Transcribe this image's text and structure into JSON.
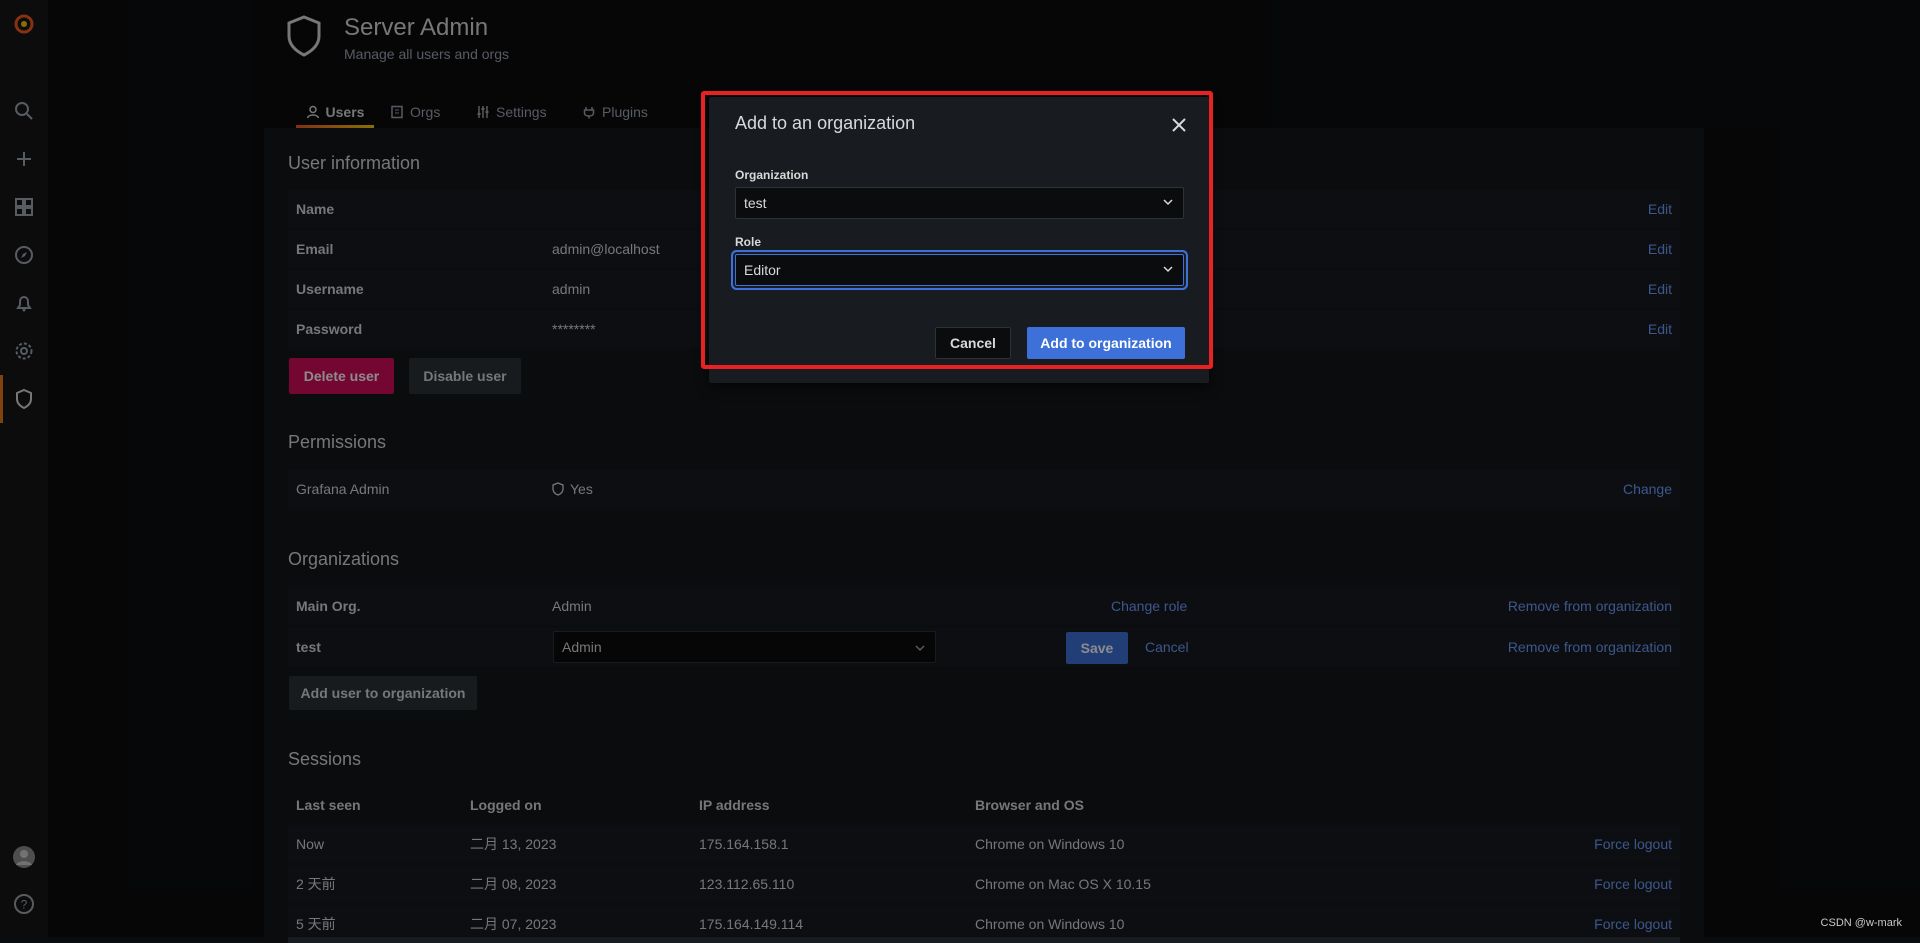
{
  "header": {
    "title": "Server Admin",
    "subtitle": "Manage all users and orgs"
  },
  "tabs": [
    {
      "label": "Users",
      "active": true
    },
    {
      "label": "Orgs",
      "active": false
    },
    {
      "label": "Settings",
      "active": false
    },
    {
      "label": "Plugins",
      "active": false
    }
  ],
  "sidebar": {
    "icons": [
      "grafana-logo-icon",
      "search-icon",
      "plus-icon",
      "dashboards-icon",
      "explore-icon",
      "alerting-icon",
      "configuration-icon",
      "server-admin-shield-icon",
      "user-avatar-icon",
      "help-icon"
    ],
    "active": "server-admin-shield-icon"
  },
  "user_info": {
    "heading": "User information",
    "rows": [
      {
        "label": "Name",
        "value": "",
        "action": "Edit"
      },
      {
        "label": "Email",
        "value": "admin@localhost",
        "action": "Edit"
      },
      {
        "label": "Username",
        "value": "admin",
        "action": "Edit"
      },
      {
        "label": "Password",
        "value": "********",
        "action": "Edit"
      }
    ],
    "delete_label": "Delete user",
    "disable_label": "Disable user"
  },
  "permissions": {
    "heading": "Permissions",
    "label": "Grafana Admin",
    "value": "Yes",
    "action": "Change"
  },
  "organizations": {
    "heading": "Organizations",
    "rows": [
      {
        "name": "Main Org.",
        "role": "Admin",
        "change": "Change role",
        "remove": "Remove from organization"
      },
      {
        "name": "test",
        "role_select": "Admin",
        "save": "Save",
        "cancel": "Cancel",
        "remove": "Remove from organization"
      }
    ],
    "add_label": "Add user to organization"
  },
  "sessions": {
    "heading": "Sessions",
    "columns": [
      "Last seen",
      "Logged on",
      "IP address",
      "Browser and OS"
    ],
    "rows": [
      {
        "last_seen": "Now",
        "logged_on": "二月 13, 2023",
        "ip": "175.164.158.1",
        "browser": "Chrome on Windows 10",
        "action": "Force logout"
      },
      {
        "last_seen": "2 天前",
        "logged_on": "二月 08, 2023",
        "ip": "123.112.65.110",
        "browser": "Chrome on Mac OS X 10.15",
        "action": "Force logout"
      },
      {
        "last_seen": "5 天前",
        "logged_on": "二月 07, 2023",
        "ip": "175.164.149.114",
        "browser": "Chrome on Windows 10",
        "action": "Force logout"
      }
    ]
  },
  "modal": {
    "title": "Add to an organization",
    "org_label": "Organization",
    "org_value": "test",
    "role_label": "Role",
    "role_value": "Editor",
    "cancel_label": "Cancel",
    "submit_label": "Add to organization"
  },
  "watermark": "CSDN @w-mark",
  "colors": {
    "accent_orange": "#eb7b18",
    "primary_blue": "#3d71d9",
    "danger": "#d10e5c",
    "highlight_red": "#e82222",
    "link": "#6e9fff"
  }
}
